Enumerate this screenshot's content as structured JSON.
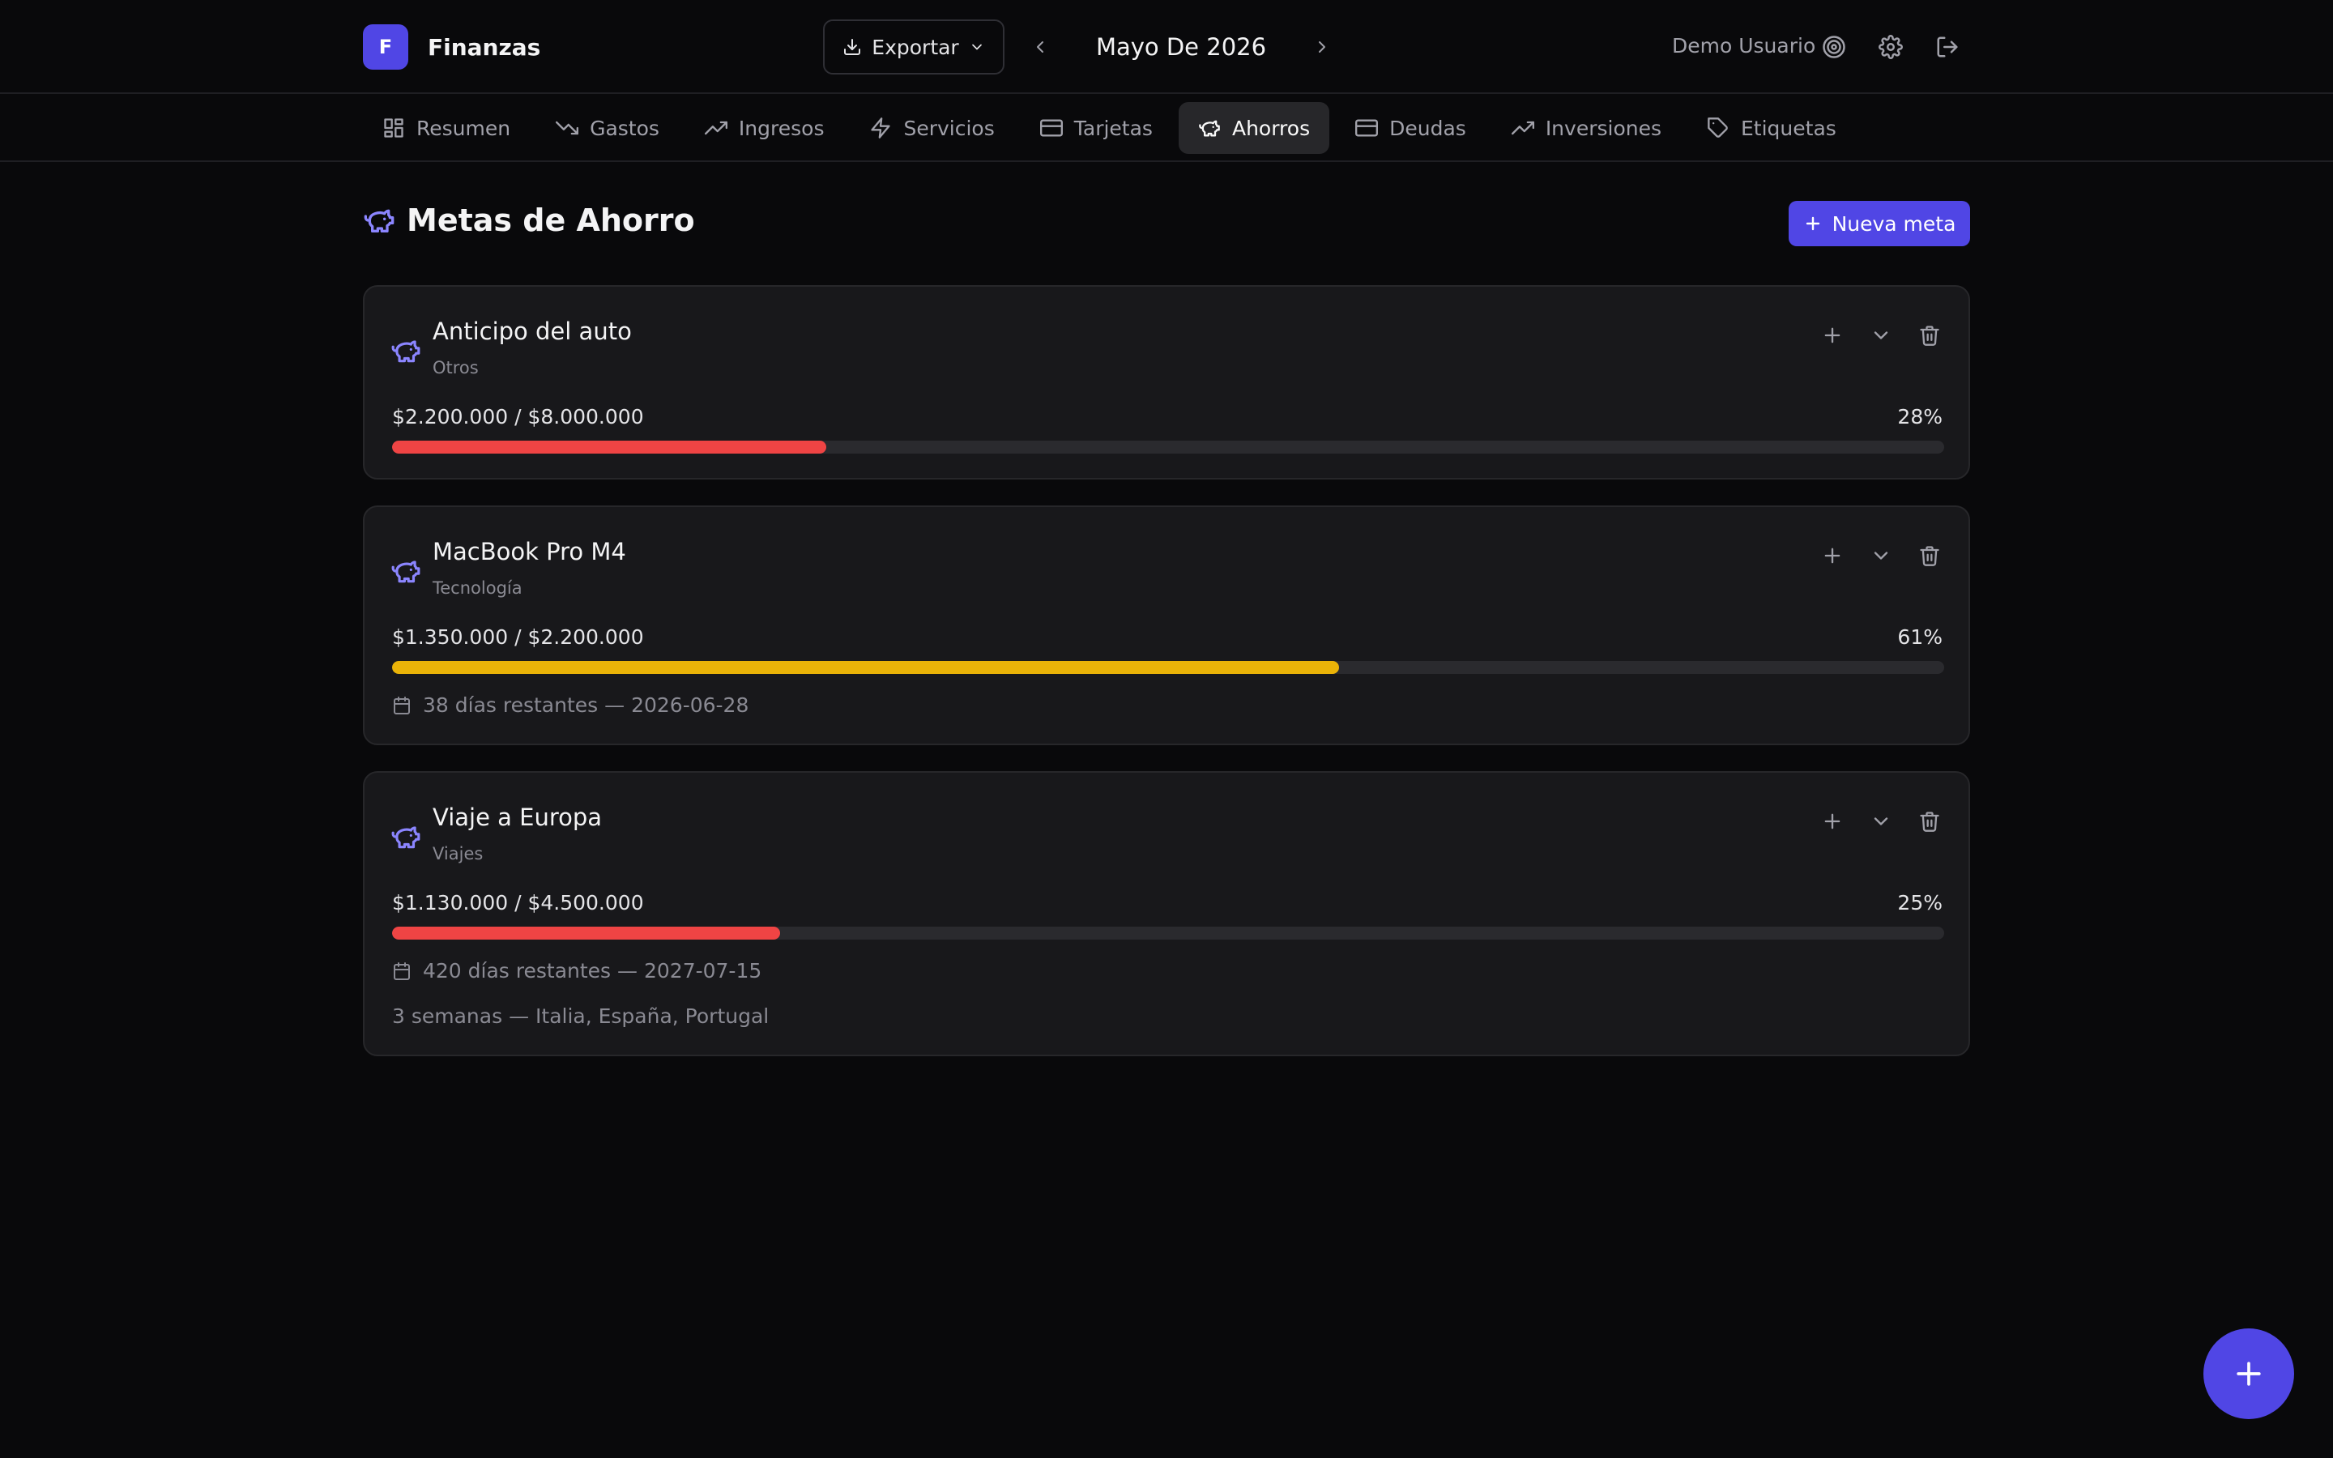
{
  "header": {
    "brand_letter": "F",
    "brand_name": "Finanzas",
    "export_label": "Exportar",
    "month_label": "Mayo De 2026",
    "user_name": "Demo Usuario"
  },
  "tabs": [
    {
      "label": "Resumen",
      "icon": "dashboard-icon",
      "active": false
    },
    {
      "label": "Gastos",
      "icon": "trending-down-icon",
      "active": false
    },
    {
      "label": "Ingresos",
      "icon": "trending-up-icon",
      "active": false
    },
    {
      "label": "Servicios",
      "icon": "zap-icon",
      "active": false
    },
    {
      "label": "Tarjetas",
      "icon": "credit-card-icon",
      "active": false
    },
    {
      "label": "Ahorros",
      "icon": "piggy-bank-icon",
      "active": true
    },
    {
      "label": "Deudas",
      "icon": "credit-card-icon",
      "active": false
    },
    {
      "label": "Inversiones",
      "icon": "trending-up-icon",
      "active": false
    },
    {
      "label": "Etiquetas",
      "icon": "tag-icon",
      "active": false
    }
  ],
  "page": {
    "title": "Metas de Ahorro",
    "new_goal_label": "Nueva meta"
  },
  "goals": [
    {
      "name": "Anticipo del auto",
      "category": "Otros",
      "amounts": "$2.200.000 / $8.000.000",
      "percent_label": "28%",
      "progress": 0.28,
      "bar_color": "#ef4444",
      "deadline": "",
      "note": ""
    },
    {
      "name": "MacBook Pro M4",
      "category": "Tecnología",
      "amounts": "$1.350.000 / $2.200.000",
      "percent_label": "61%",
      "progress": 0.61,
      "bar_color": "#eab308",
      "deadline": "38 días restantes — 2026-06-28",
      "note": ""
    },
    {
      "name": "Viaje a Europa",
      "category": "Viajes",
      "amounts": "$1.130.000 / $4.500.000",
      "percent_label": "25%",
      "progress": 0.25,
      "bar_color": "#ef4444",
      "deadline": "420 días restantes — 2027-07-15",
      "note": "3 semanas — Italia, España, Portugal"
    }
  ],
  "colors": {
    "accent": "#5046e5",
    "piggy_icon": "#8b85ff"
  }
}
